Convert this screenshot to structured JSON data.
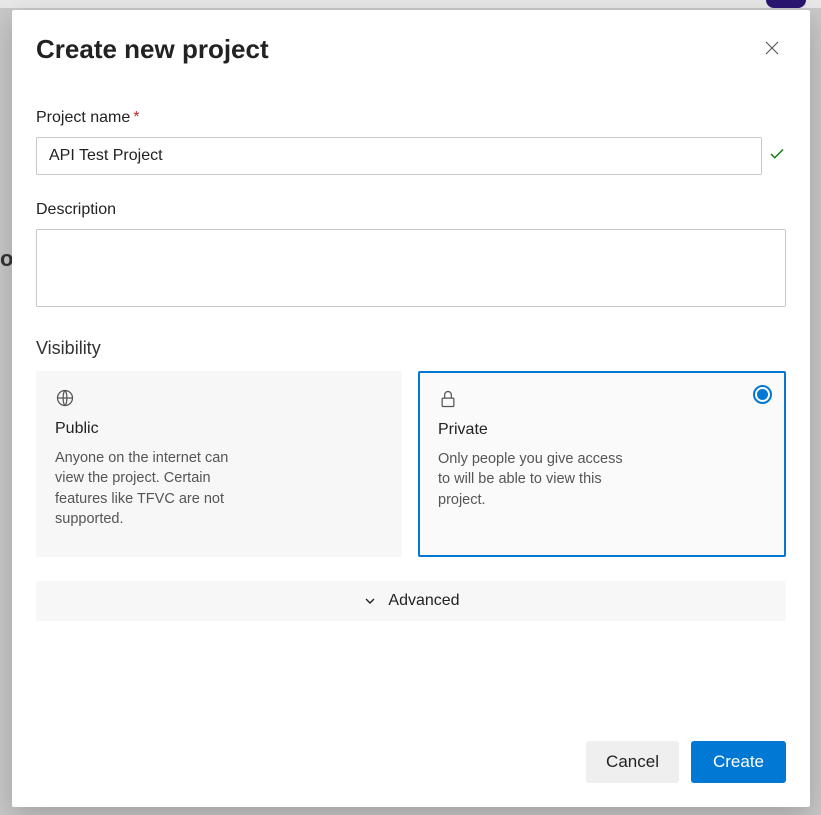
{
  "backdrop": {
    "partial_text": "oj"
  },
  "dialog": {
    "title": "Create new project",
    "project_name": {
      "label": "Project name",
      "required": "*",
      "value": "API Test Project"
    },
    "description": {
      "label": "Description",
      "value": ""
    },
    "visibility": {
      "label": "Visibility",
      "options": [
        {
          "title": "Public",
          "description": "Anyone on the internet can view the project. Certain features like TFVC are not supported.",
          "selected": false
        },
        {
          "title": "Private",
          "description": "Only people you give access to will be able to view this project.",
          "selected": true
        }
      ]
    },
    "advanced_label": "Advanced",
    "footer": {
      "cancel": "Cancel",
      "create": "Create"
    }
  }
}
